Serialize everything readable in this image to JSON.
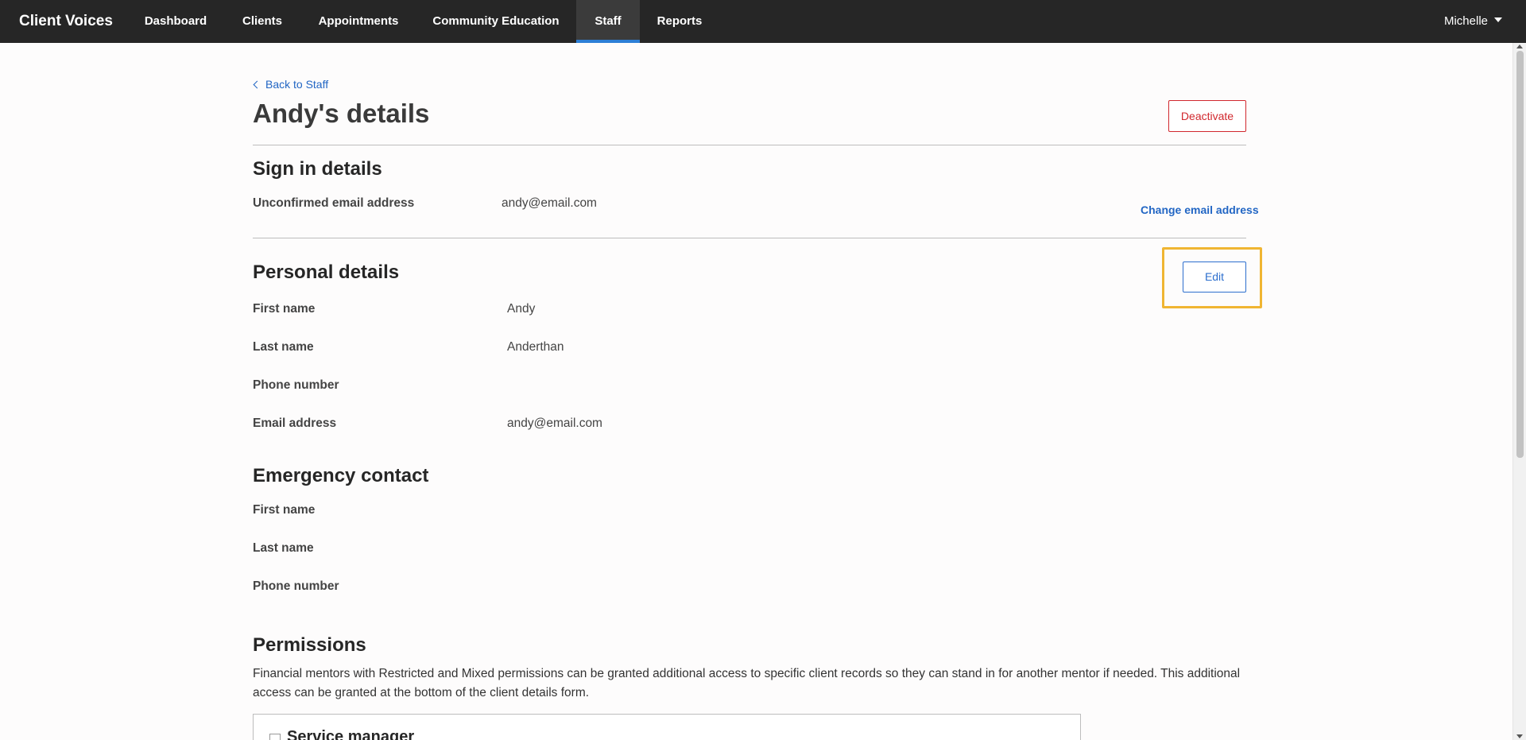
{
  "nav": {
    "brand": "Client Voices",
    "items": [
      {
        "label": "Dashboard"
      },
      {
        "label": "Clients"
      },
      {
        "label": "Appointments"
      },
      {
        "label": "Community Education"
      },
      {
        "label": "Staff"
      },
      {
        "label": "Reports"
      }
    ],
    "active": "Staff",
    "user": "Michelle"
  },
  "page": {
    "back_link": "Back to Staff",
    "title": "Andy's details",
    "deactivate_label": "Deactivate"
  },
  "sign_in": {
    "title": "Sign in details",
    "email_label": "Unconfirmed email address",
    "email_value": "andy@email.com",
    "change_email_link": "Change email address"
  },
  "personal": {
    "title": "Personal details",
    "edit_label": "Edit",
    "fields": [
      {
        "label": "First name",
        "value": "Andy"
      },
      {
        "label": "Last name",
        "value": "Anderthan"
      },
      {
        "label": "Phone number",
        "value": ""
      },
      {
        "label": "Email address",
        "value": "andy@email.com"
      }
    ]
  },
  "emergency": {
    "title": "Emergency contact",
    "fields": [
      {
        "label": "First name"
      },
      {
        "label": "Last name"
      },
      {
        "label": "Phone number"
      }
    ]
  },
  "permissions": {
    "title": "Permissions",
    "description": "Financial mentors with Restricted and Mixed permissions can be granted additional access to specific client records so they can stand in for another mentor if needed. This additional access can be granted at the bottom of the client details form.",
    "options": [
      {
        "label": "Service manager"
      }
    ]
  },
  "colors": {
    "nav_bg": "#262626",
    "accent": "#2d7fd6",
    "link": "#2266c4",
    "danger": "#d1282e",
    "highlight": "#f0b532"
  }
}
